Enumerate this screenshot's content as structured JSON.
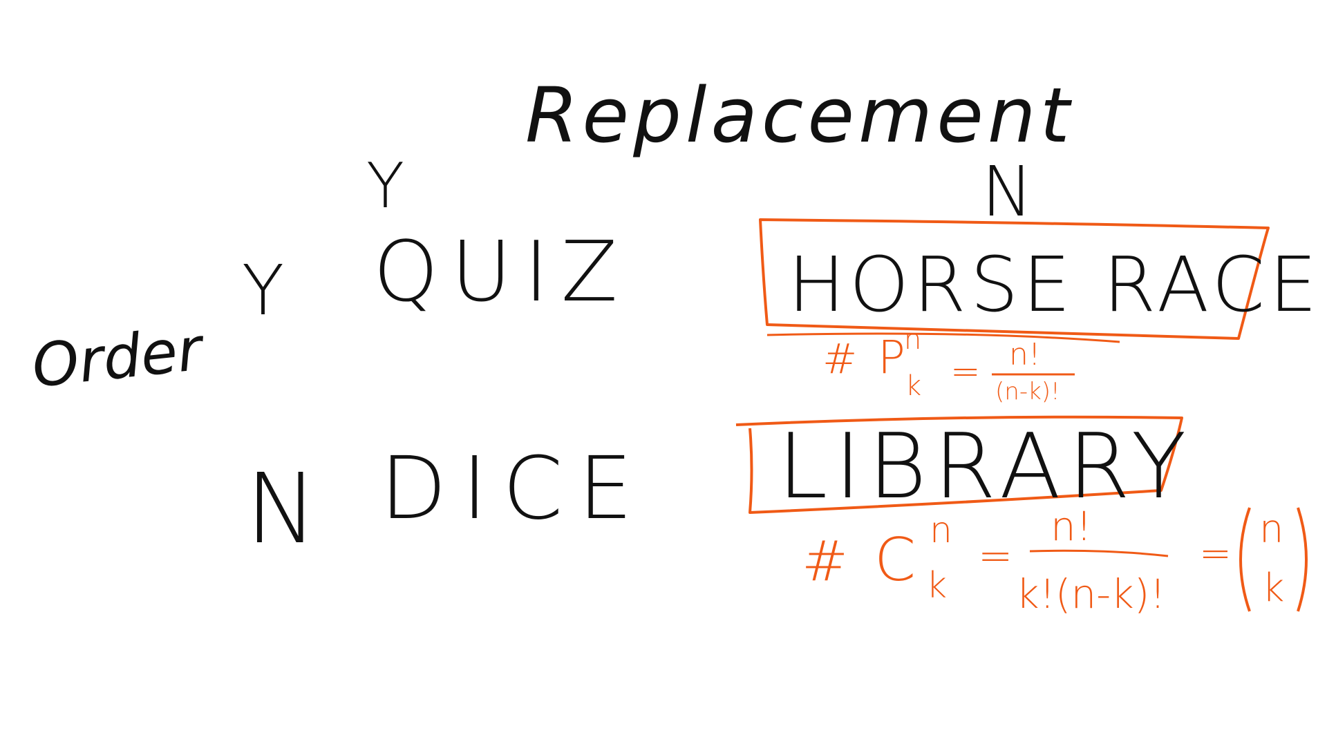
{
  "colors": {
    "ink": "#111111",
    "accent": "#f05a16",
    "background": "#ffffff"
  },
  "headers": {
    "columns_title": "Replacement",
    "column_yes": "Y",
    "column_no": "N",
    "rows_title": "Order"
  },
  "rows": {
    "yes": {
      "label": "Y",
      "with_replacement": "QUIZ",
      "without_replacement": "HORSE RACE"
    },
    "no": {
      "label": "N",
      "with_replacement": "DICE",
      "without_replacement": "LIBRARY"
    }
  },
  "formulas": {
    "permutation": {
      "hash": "#",
      "symbol": "P",
      "superscript": "n",
      "subscript": "k",
      "equals": "=",
      "numerator": "n!",
      "denominator": "(n-k)!"
    },
    "combination": {
      "hash": "#",
      "symbol": "C",
      "superscript": "n",
      "subscript": "k",
      "equals": "=",
      "numerator": "n!",
      "denominator": "k!(n-k)!",
      "equals2": "=",
      "binom_top": "n",
      "binom_bottom": "k"
    }
  }
}
